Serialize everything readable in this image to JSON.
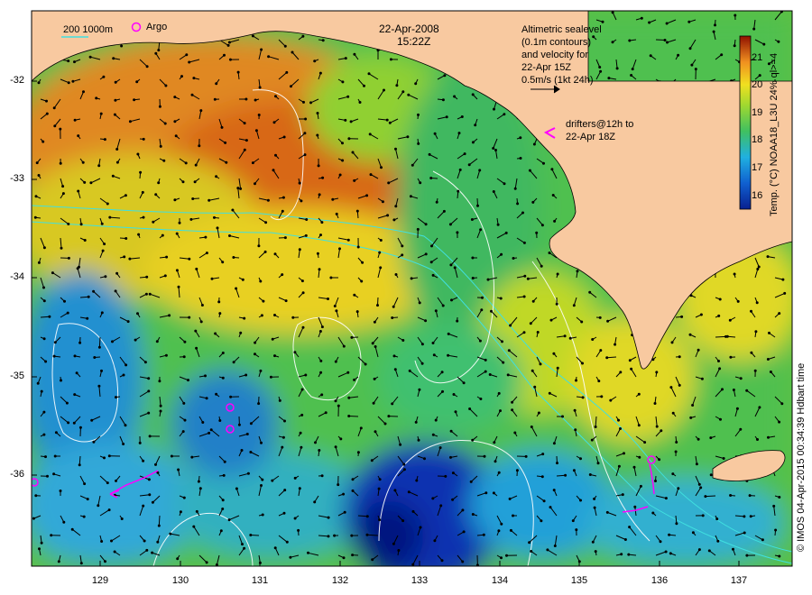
{
  "header": {
    "date": "22-Apr-2008",
    "time": "15:22Z"
  },
  "legend": {
    "bathymetry": "200  1000m",
    "argo": "Argo",
    "altimetry_lines": [
      "Altimetric sealevel",
      "(0.1m contours)",
      "and velocity for",
      "22-Apr 15Z",
      "0.5m/s (1kt 24h)"
    ],
    "drifter_lines": [
      "drifters@12h to",
      "22-Apr 18Z"
    ]
  },
  "colorbar": {
    "label": "Temp. (°C) NOAA18_L3U 24% ql>=4",
    "ticks": [
      "21",
      "20",
      "19",
      "18",
      "17",
      "16"
    ]
  },
  "axes": {
    "x_ticks": [
      "129",
      "130",
      "131",
      "132",
      "133",
      "134",
      "135",
      "136",
      "137"
    ],
    "y_ticks": [
      "-32",
      "-33",
      "-34",
      "-35",
      "-36"
    ]
  },
  "credit": "© IMOS 04-Apr-2015 00:34:39 Hdbart time",
  "colors": {
    "land": "#f8c9a0",
    "coast": "#000000",
    "sst_warm": "#e06818",
    "sst_mid": "#f0d020",
    "sst_green": "#40c040",
    "sst_cool": "#20a0e0",
    "sst_cold": "#082090",
    "argo": "#ff00ff",
    "drifter": "#ff00ff",
    "bathymetry": "#40e0e0"
  }
}
